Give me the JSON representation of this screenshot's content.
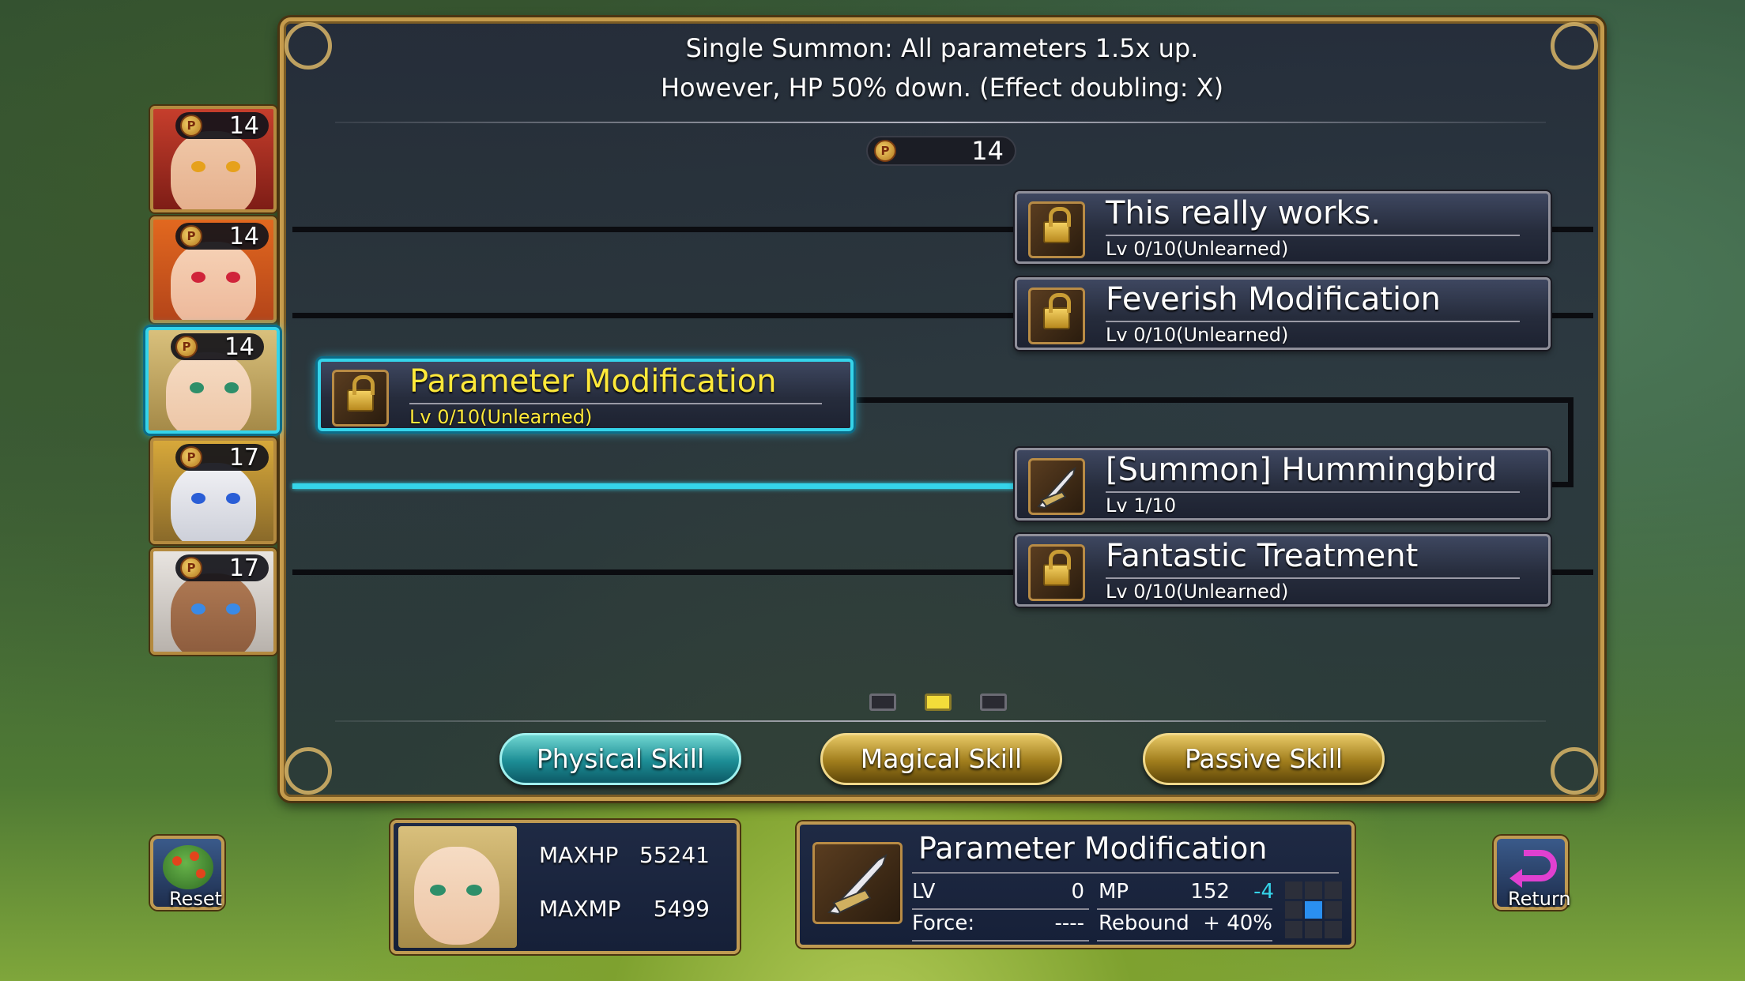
{
  "description": {
    "line1": "Single Summon: All parameters 1.5x up.",
    "line2": "However, HP 50% down. (Effect doubling: X)"
  },
  "points": {
    "icon": "P",
    "value": "14"
  },
  "characters": [
    {
      "points": "14",
      "selected": false
    },
    {
      "points": "14",
      "selected": false
    },
    {
      "points": "14",
      "selected": true
    },
    {
      "points": "17",
      "selected": false
    },
    {
      "points": "17",
      "selected": false
    }
  ],
  "skills": {
    "selected": {
      "name": "Parameter Modification",
      "level": "Lv 0/10(Unlearned)",
      "icon": "lock-icon"
    },
    "nodes": [
      {
        "name": "This really works.",
        "level": "Lv 0/10(Unlearned)",
        "icon": "lock-icon"
      },
      {
        "name": "Feverish Modification",
        "level": "Lv 0/10(Unlearned)",
        "icon": "lock-icon"
      },
      {
        "name": "[Summon] Hummingbird",
        "level": "Lv 1/10",
        "icon": "scissors-blade-icon"
      },
      {
        "name": "Fantastic Treatment",
        "level": "Lv 0/10(Unlearned)",
        "icon": "lock-icon"
      }
    ]
  },
  "pages": {
    "count": 3,
    "current": 2
  },
  "tabs": {
    "physical": "Physical Skill",
    "magical": "Magical Skill",
    "passive": "Passive Skill"
  },
  "status": {
    "maxhp_label": "MAXHP",
    "maxhp": "55241",
    "maxmp_label": "MAXMP",
    "maxmp": "5499"
  },
  "detail": {
    "name": "Parameter Modification",
    "lv_label": "LV",
    "lv": "0",
    "mp_label": "MP",
    "mp": "152",
    "mp_delta": "-4",
    "force_label": "Force:",
    "force": "----",
    "rebound_label": "Rebound",
    "rebound": "+ 40%"
  },
  "buttons": {
    "reset": "Reset",
    "return": "Return"
  },
  "colors": {
    "accent": "#35d4ea",
    "highlight": "#ffe93a",
    "frame": "#c59b4c"
  }
}
